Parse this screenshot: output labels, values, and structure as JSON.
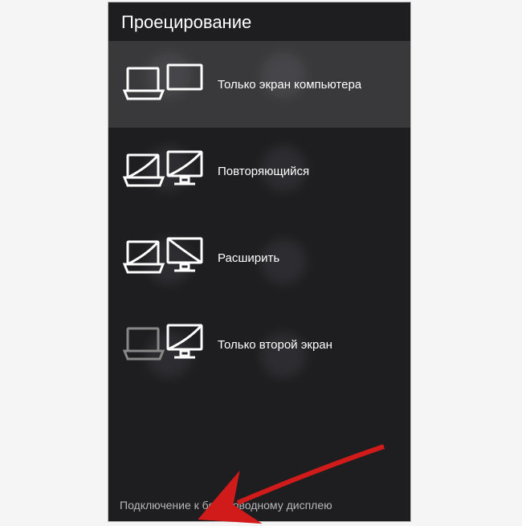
{
  "panel": {
    "title": "Проецирование",
    "options": [
      {
        "label": "Только экран компьютера",
        "selected": true,
        "mode": "pc-only"
      },
      {
        "label": "Повторяющийся",
        "selected": false,
        "mode": "duplicate"
      },
      {
        "label": "Расширить",
        "selected": false,
        "mode": "extend"
      },
      {
        "label": "Только второй экран",
        "selected": false,
        "mode": "second-only"
      }
    ],
    "footer_link": "Подключение к беспроводному дисплею"
  },
  "annotation": {
    "arrow_color": "#d11b1b"
  }
}
